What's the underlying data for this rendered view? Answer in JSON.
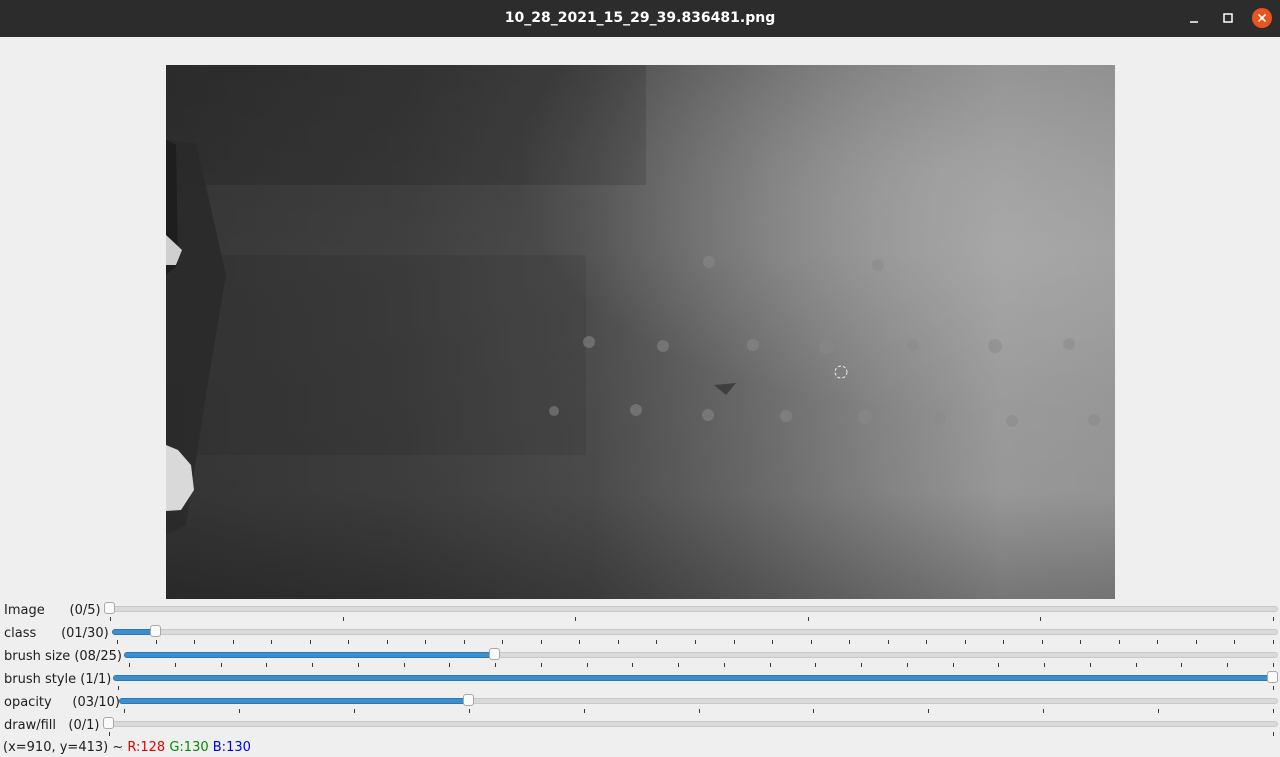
{
  "window": {
    "title": "10_28_2021_15_29_39.836481.png",
    "close_color": "#e95420"
  },
  "trackbars": [
    {
      "label": "Image      (0/5)",
      "value": 0,
      "max": 5
    },
    {
      "label": "class      (01/30)",
      "value": 1,
      "max": 30
    },
    {
      "label": "brush size (08/25)",
      "value": 8,
      "max": 25
    },
    {
      "label": "brush style (1/1)",
      "value": 1,
      "max": 1
    },
    {
      "label": "opacity     (03/10)",
      "value": 3,
      "max": 10
    },
    {
      "label": "draw/fill   (0/1)",
      "value": 0,
      "max": 1
    }
  ],
  "status": {
    "coords": "(x=910, y=413) ~ ",
    "r": "R:128",
    "g": "G:130",
    "b": "B:130"
  },
  "colors": {
    "slider_fill": "#3b8fd0",
    "titlebar": "#2c2c2c"
  }
}
